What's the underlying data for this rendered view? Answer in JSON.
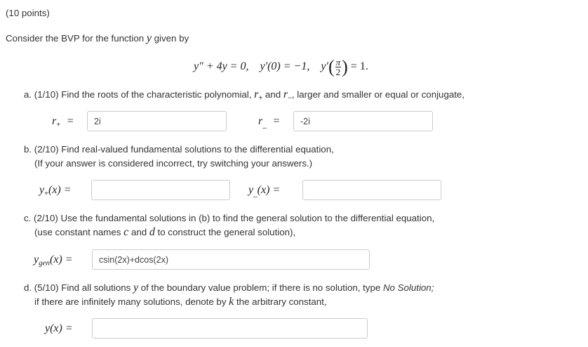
{
  "header": {
    "points": "(10 points)"
  },
  "intro": {
    "text_before": "Consider the BVP for the function ",
    "func": "y",
    "text_after": " given by"
  },
  "equation": {
    "ode": "y″ + 4y = 0,",
    "bc1": "y′(0) = −1,",
    "bc2_prefix": "y′",
    "bc2_num": "π",
    "bc2_den": "2",
    "bc2_suffix": "= 1."
  },
  "part_a": {
    "text": "a. (1/10) Find the roots of the characteristic polynomial, ",
    "rplus_sym": "r",
    "plus_sub": "+",
    "and": " and ",
    "rminus_sym": "r",
    "minus_sub": "−",
    "text_end": ", larger and smaller or equal or conjugate,",
    "rplus_label": "r",
    "rplus_label_sub": "+",
    "rplus_eq": "=",
    "rplus_value": "2i",
    "rminus_label": "r",
    "rminus_label_sub": "_",
    "rminus_eq": "=",
    "rminus_value": "-2i"
  },
  "part_b": {
    "line1": "b. (2/10) Find real-valued fundamental solutions to the differential equation,",
    "line2": "(If your answer is considered incorrect, try switching your answers.)",
    "yplus_label": "y",
    "yplus_sub": "+",
    "yplus_arg": "(x) =",
    "yplus_value": "",
    "yminus_label": "y",
    "yminus_sub": "_",
    "yminus_arg": "(x) =",
    "yminus_value": ""
  },
  "part_c": {
    "line1": "c. (2/10) Use the fundamental solutions in (b) to find the general solution to the differential equation,",
    "line2_a": "(use constant names ",
    "c": "c",
    "line2_b": " and ",
    "d": "d",
    "line2_c": " to construct the general solution),",
    "ygen_label": "y",
    "ygen_sub": "gen",
    "ygen_arg": "(x) =",
    "ygen_value": "csin(2x)+dcos(2x)"
  },
  "part_d": {
    "line1_a": "d. (5/10) Find all solutions ",
    "y": "y",
    "line1_b": " of the boundary value problem; if there is no solution, type ",
    "no_solution": "No Solution;",
    "line2_a": "if there are infinitely many solutions, denote by ",
    "k": "k",
    "line2_b": " the arbitrary constant,",
    "y_label": "y(x) =",
    "y_value": ""
  }
}
